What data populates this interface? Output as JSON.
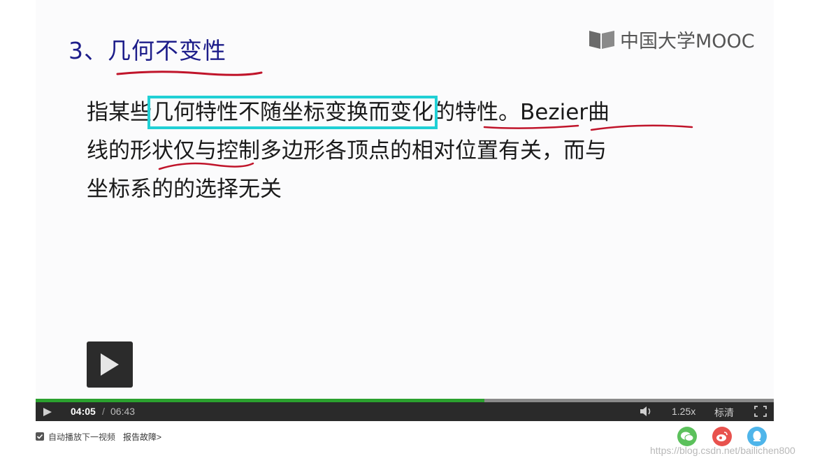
{
  "slide": {
    "title": "3、几何不变性",
    "logo_text": "中国大学MOOC",
    "body": {
      "line1_a": "指某些",
      "line1_highlight": "几何特性不随坐标变换而变化",
      "line1_b": "的特性。Bezier曲",
      "line2": "线的形状仅与控制多边形各顶点的相对位置有关，而与",
      "line3": "坐标系的的选择无关"
    },
    "highlight_color": "#20d0d5",
    "underline_color": "#c0142a"
  },
  "player": {
    "current_time": "04:05",
    "separator": "/",
    "total_time": "06:43",
    "progress_fraction": 0.608,
    "speed": "1.25x",
    "quality": "标清",
    "icons": [
      "play-icon",
      "volume-icon",
      "fullscreen-icon"
    ]
  },
  "below_bar": {
    "autoplay_label": "自动播放下一视频",
    "autoplay_checked": true,
    "report_label": "报告故障>"
  },
  "share": {
    "icons": [
      "wechat-icon",
      "weibo-icon",
      "qq-icon"
    ],
    "colors": [
      "#5cc15c",
      "#e8524e",
      "#4fb5ea"
    ]
  },
  "watermark": "https://blog.csdn.net/bailichen800"
}
